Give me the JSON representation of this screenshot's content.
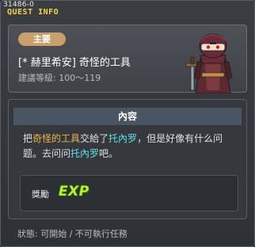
{
  "window": {
    "quest_id": "31486-0",
    "title": "QUEST INFO"
  },
  "header": {
    "type_badge": "主要",
    "quest_name": "[* 赫里希安] 奇怪的工具",
    "level_requirement": "建議等級: 100～119",
    "npc_icon": "npc-masked-warrior-icon"
  },
  "content": {
    "section_title": "內容",
    "description": {
      "part1": "把",
      "item": "奇怪的工具",
      "part2": "交給了",
      "npc1": "托內罗",
      "part3": "，但是好像有什么问题。去问问",
      "npc2": "托內罗",
      "part4": "吧。"
    },
    "reward": {
      "label": "獎勵",
      "exp_label": "EXP"
    }
  },
  "status": {
    "text": "狀態: 可開始 / 不可執行任務"
  },
  "colors": {
    "title": "#f2d346",
    "badge": "#c9a06b",
    "highlight_item": "#f0b34a",
    "highlight_npc": "#5fe0e8",
    "exp": "#b6ee3a"
  }
}
